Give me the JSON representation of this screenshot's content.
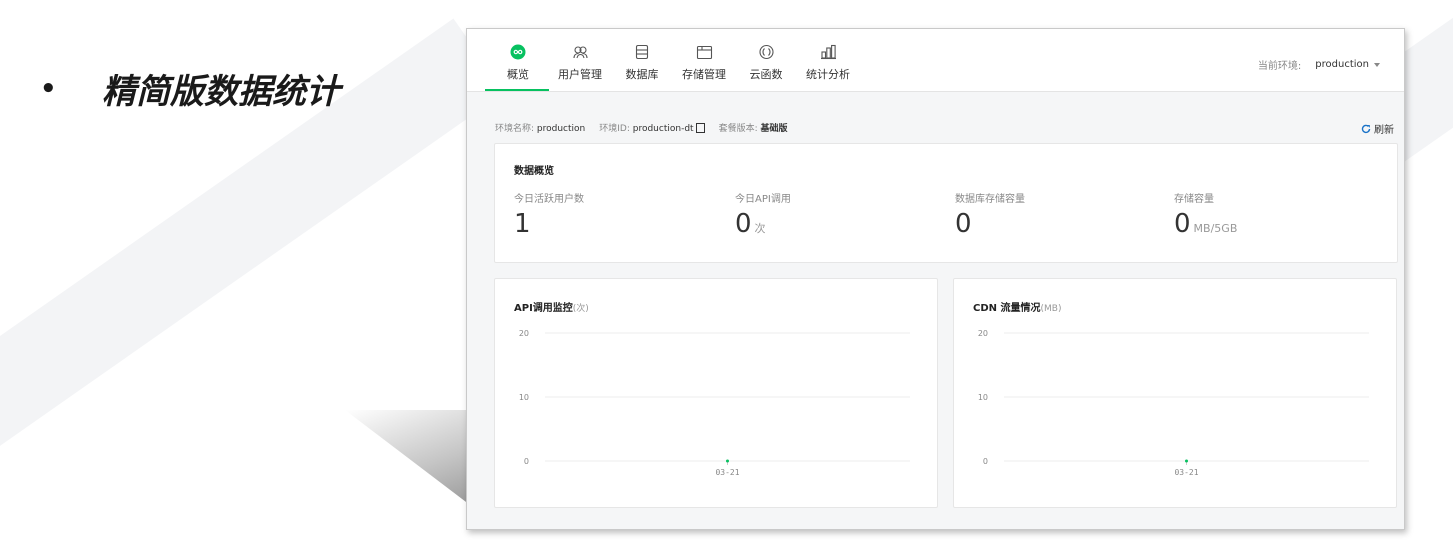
{
  "slide": {
    "bullet_symbol": "•",
    "heading": "精简版数据统计"
  },
  "nav": {
    "tabs": [
      {
        "label": "概览",
        "icon": "infinity-icon",
        "active": true
      },
      {
        "label": "用户管理",
        "icon": "users-icon",
        "active": false
      },
      {
        "label": "数据库",
        "icon": "database-icon",
        "active": false
      },
      {
        "label": "存储管理",
        "icon": "folder-icon",
        "active": false
      },
      {
        "label": "云函数",
        "icon": "function-icon",
        "active": false
      },
      {
        "label": "统计分析",
        "icon": "bar-chart-icon",
        "active": false
      }
    ],
    "env_label": "当前环境:",
    "env_value": "production"
  },
  "info": {
    "name_label": "环境名称:",
    "name_value": "production",
    "id_label": "环境ID:",
    "id_value": "production-dt",
    "plan_label": "套餐版本:",
    "plan_value": "基础版",
    "refresh_label": "刷新"
  },
  "overview": {
    "title": "数据概览",
    "stats": [
      {
        "label": "今日活跃用户数",
        "value": "1",
        "unit": ""
      },
      {
        "label": "今日API调用",
        "value": "0",
        "unit": "次"
      },
      {
        "label": "数据库存储容量",
        "value": "0",
        "unit": ""
      },
      {
        "label": "存储容量",
        "value": "0",
        "unit": "MB/5GB"
      }
    ]
  },
  "colors": {
    "accent": "#07c160"
  },
  "chart_data": [
    {
      "type": "line",
      "title": "API调用监控",
      "unit": "(次)",
      "x": [
        "03-21"
      ],
      "series": [
        {
          "values": [
            0
          ]
        }
      ],
      "yticks": [
        0,
        10,
        20
      ],
      "ylim": [
        0,
        20
      ],
      "grid": true
    },
    {
      "type": "line",
      "title": "CDN 流量情况",
      "unit": "(MB)",
      "x": [
        "03-21"
      ],
      "series": [
        {
          "values": [
            0
          ]
        }
      ],
      "yticks": [
        0,
        10,
        20
      ],
      "ylim": [
        0,
        20
      ],
      "grid": true
    }
  ]
}
